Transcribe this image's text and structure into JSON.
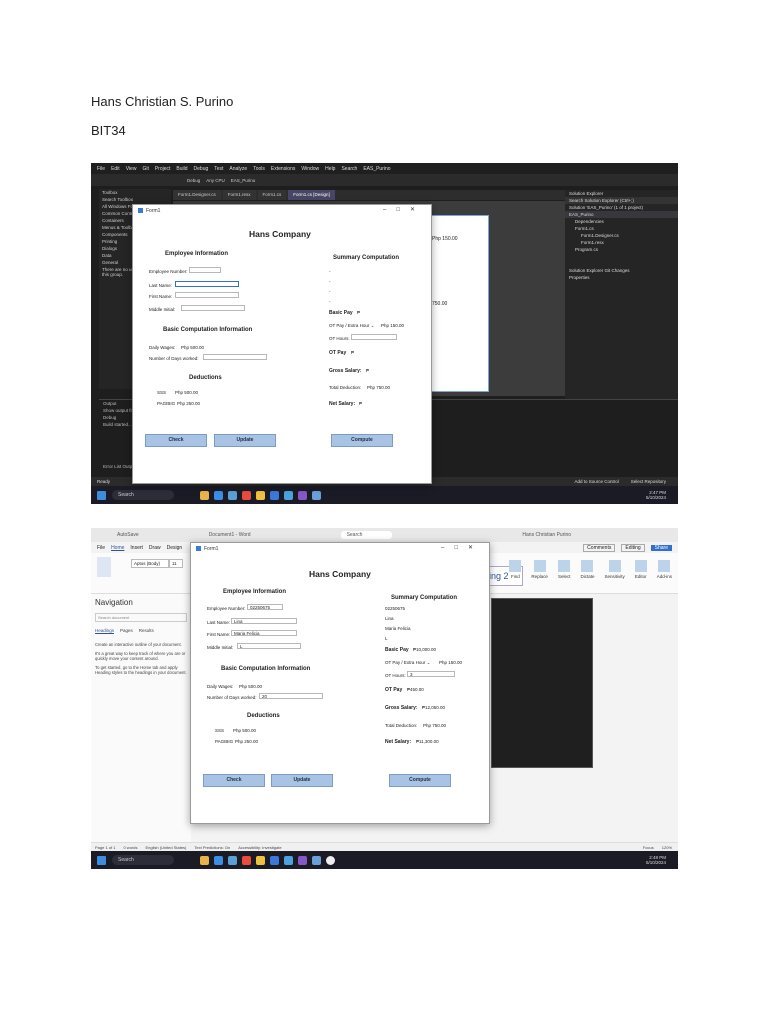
{
  "document": {
    "author": "Hans Christian S. Purino",
    "section": "BIT34"
  },
  "screenshot1": {
    "vs_menu": [
      "File",
      "Edit",
      "View",
      "Git",
      "Project",
      "Build",
      "Debug",
      "Test",
      "Analyze",
      "Tools",
      "Extensions",
      "Window",
      "Help",
      "Search",
      "EAS_Purino"
    ],
    "vs_toolbar": [
      "Debug",
      "Any CPU",
      "EAS_Purino"
    ],
    "toolbox_items": [
      "Toolbox",
      "Search Toolbox",
      "All Windows Forms",
      "Common Controls",
      "Containers",
      "Menus & Toolbars",
      "Components",
      "Printing",
      "Dialogs",
      "Data",
      "General"
    ],
    "toolbox_note": "There are no usable controls in this group.",
    "tabs": [
      "Form1.Designer.cs",
      "Form1.resx",
      "Form1.cs",
      "Form1.cs [Design]"
    ],
    "solution_title": "Solution Explorer",
    "solution_items": [
      "Search Solution Explorer (Ctrl+;)",
      "Solution 'EAS_Purino' (1 of 1 project)",
      "EAS_Purino",
      "Dependencies",
      "Form1.cs",
      "Form1.Designer.cs",
      "Form1.resx",
      "Program.cs"
    ],
    "solution_footer": "Solution Explorer   Git Changes",
    "properties_title": "Properties",
    "output_title": "Output",
    "output_lines": [
      "Show output from:",
      "Debug",
      "Build started..."
    ],
    "error_list": "Error List   Output",
    "status": "Ready",
    "status_right": [
      "Add to Source Control",
      "Select Repository"
    ],
    "bg_form": {
      "otpay": "Php 150.00",
      "php": "750.00"
    },
    "taskbar": {
      "search": "Search",
      "time": "2:47 PM",
      "date": "5/10/2024"
    },
    "form": {
      "window_title": "Form1",
      "app_title": "Hans Company",
      "employee_header": "Employee Information",
      "employee_number_label": "Employee Number:",
      "last_name_label": "Last Name:",
      "first_name_label": "First Name:",
      "middle_initial_label": "Middle Initial:",
      "employee_number": "",
      "last_name": "",
      "first_name": "",
      "middle_initial": "",
      "basic_header": "Basic Computation Information",
      "daily_wages_label": "Daily Wages:",
      "daily_wages": "Php 500.00",
      "days_worked_label": "Number of Days worked:",
      "days_worked": "",
      "deductions_header": "Deductions",
      "sss_label": "SSS",
      "sss": "Php 500.00",
      "pagibig_label": "PAGIBIG",
      "pagibig": "Php 250.00",
      "summary_header": "Summary Computation",
      "summary_lines": [
        "-",
        "-",
        "-",
        "-"
      ],
      "basic_pay_label": "Basic Pay",
      "basic_pay": "₱",
      "ot_rate_label": "OT Pay / Extra Hour ⌄",
      "ot_rate": "Php 150.00",
      "ot_hours_label": "OT Hours:",
      "ot_hours": "",
      "ot_pay_label": "OT Pay",
      "ot_pay": "₱",
      "gross_label": "Gross Salary:",
      "gross": "₱",
      "total_deduction_label": "Total Deduction:",
      "total_deduction": "Php 750.00",
      "net_label": "Net Salary:",
      "net": "₱",
      "check_btn": "Check",
      "update_btn": "Update",
      "compute_btn": "Compute"
    }
  },
  "screenshot2": {
    "word_title": [
      "AutoSave",
      "Document1 - Word",
      "Search",
      "Hans Christian Purino"
    ],
    "word_menu": [
      "File",
      "Home",
      "Insert",
      "Draw",
      "Design"
    ],
    "font_name": "Aptos (Body)",
    "font_size": "11",
    "style_name": "ling 2",
    "ribbon_right": [
      "Find",
      "Replace",
      "Select",
      "Dictate",
      "Sensitivity",
      "Editor",
      "Add-ins"
    ],
    "ribbon_buttons": [
      "Comments",
      "Editing",
      "Share"
    ],
    "nav": {
      "title": "Navigation",
      "search": "Search document",
      "tabs": [
        "Headings",
        "Pages",
        "Results"
      ],
      "para1": "Create an interactive outline of your document.",
      "para2": "It's a great way to keep track of where you are or quickly move your content around.",
      "para3": "To get started, go to the Home tab and apply Heading styles to the headings in your document."
    },
    "word_status": [
      "Page 1 of 1",
      "0 words",
      "English (United States)",
      "Text Predictions: On",
      "Accessibility: Investigate",
      "Focus",
      "120%"
    ],
    "taskbar": {
      "search": "Search",
      "time": "2:48 PM",
      "date": "5/10/2024"
    },
    "form": {
      "window_title": "Form1",
      "app_title": "Hans Company",
      "employee_header": "Employee Information",
      "employee_number_label": "Employee Number:",
      "last_name_label": "Last Name:",
      "first_name_label": "First Name:",
      "middle_initial_label": "Middle Initial:",
      "employee_number": "02250675",
      "last_name": "Lina",
      "first_name": "Maria Felicia",
      "middle_initial": "L",
      "basic_header": "Basic Computation Information",
      "daily_wages_label": "Daily Wages:",
      "daily_wages": "Php 500.00",
      "days_worked_label": "Number of Days worked:",
      "days_worked": "20",
      "deductions_header": "Deductions",
      "sss_label": "SSS",
      "sss": "Php 500.00",
      "pagibig_label": "PAGIBIG",
      "pagibig": "Php 250.00",
      "summary_header": "Summary Computation",
      "summary_lines": [
        "02250675",
        "Lina",
        "Maria Felicia",
        "L"
      ],
      "basic_pay_label": "Basic Pay",
      "basic_pay": "₱10,000.00",
      "ot_rate_label": "OT Pay / Extra Hour ⌄",
      "ot_rate": "Php 150.00",
      "ot_hours_label": "OT Hours:",
      "ot_hours": "3",
      "ot_pay_label": "OT Pay",
      "ot_pay": "₱450.00",
      "gross_label": "Gross Salary:",
      "gross": "₱12,050.00",
      "total_deduction_label": "Total Deduction:",
      "total_deduction": "Php 750.00",
      "net_label": "Net Salary:",
      "net": "₱11,300.00",
      "check_btn": "Check",
      "update_btn": "Update",
      "compute_btn": "Compute"
    }
  }
}
